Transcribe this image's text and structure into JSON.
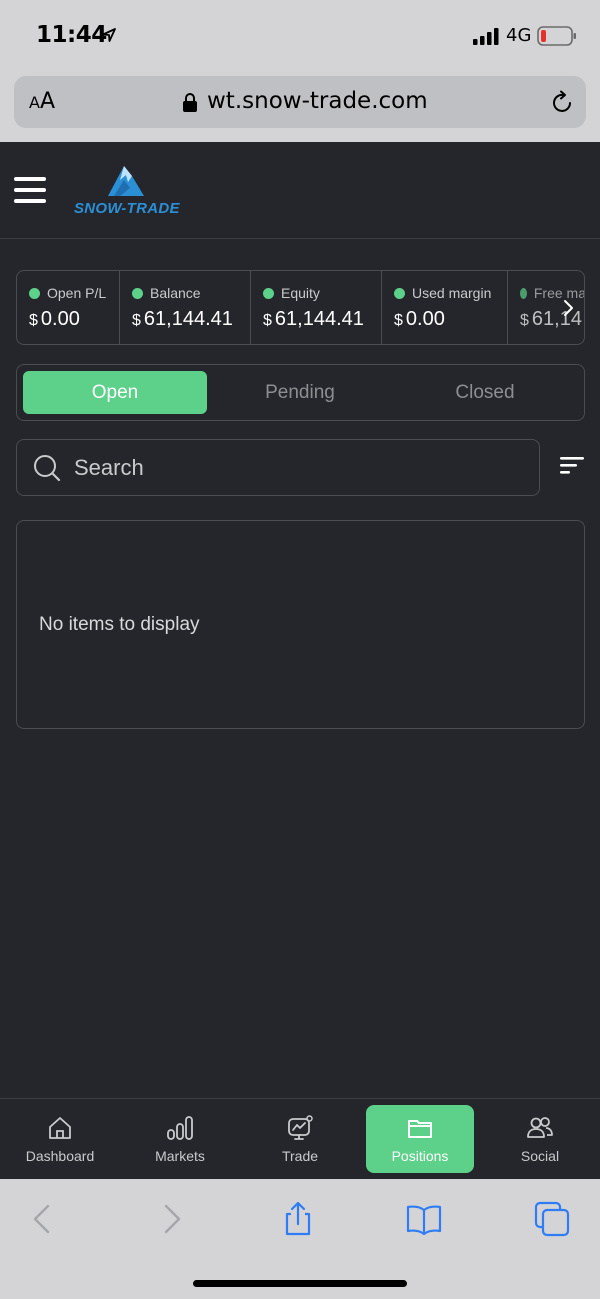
{
  "status_bar": {
    "time": "11:44",
    "network": "4G",
    "icons": [
      "location-arrow-icon",
      "signal-bars-icon",
      "battery-low-icon"
    ]
  },
  "browser": {
    "text_size_small": "A",
    "text_size_large": "A",
    "url": "wt.snow-trade.com",
    "icons": [
      "lock-icon",
      "reload-icon"
    ]
  },
  "header": {
    "logo_text": "SNOW-TRADE",
    "icons": [
      "hamburger-menu-icon",
      "mountain-logo-icon"
    ]
  },
  "summary": {
    "items": [
      {
        "label": "Open P/L",
        "currency": "$",
        "value": "0.00"
      },
      {
        "label": "Balance",
        "currency": "$",
        "value": "61,144.41"
      },
      {
        "label": "Equity",
        "currency": "$",
        "value": "61,144.41"
      },
      {
        "label": "Used margin",
        "currency": "$",
        "value": "0.00"
      },
      {
        "label": "Free ma",
        "currency": "$",
        "value": "61,14"
      }
    ],
    "dot_color": "#5dd08a"
  },
  "tabs": {
    "items": [
      {
        "label": "Open",
        "active": true
      },
      {
        "label": "Pending",
        "active": false
      },
      {
        "label": "Closed",
        "active": false
      }
    ]
  },
  "search": {
    "placeholder": "Search"
  },
  "list": {
    "empty_message": "No items to display"
  },
  "bottom_nav": {
    "items": [
      {
        "label": "Dashboard",
        "icon": "home-icon",
        "active": false
      },
      {
        "label": "Markets",
        "icon": "bar-chart-icon",
        "active": false
      },
      {
        "label": "Trade",
        "icon": "trade-chart-icon",
        "active": false
      },
      {
        "label": "Positions",
        "icon": "folder-icon",
        "active": true
      },
      {
        "label": "Social",
        "icon": "people-icon",
        "active": false
      }
    ]
  },
  "safari_toolbar": {
    "icons": [
      "back-arrow-icon",
      "forward-arrow-icon",
      "share-icon",
      "bookmarks-icon",
      "tabs-icon"
    ]
  },
  "colors": {
    "accent": "#5dd08a",
    "background": "#25262b",
    "border": "#4a4c52",
    "ios_blue": "#2f7cf6"
  }
}
